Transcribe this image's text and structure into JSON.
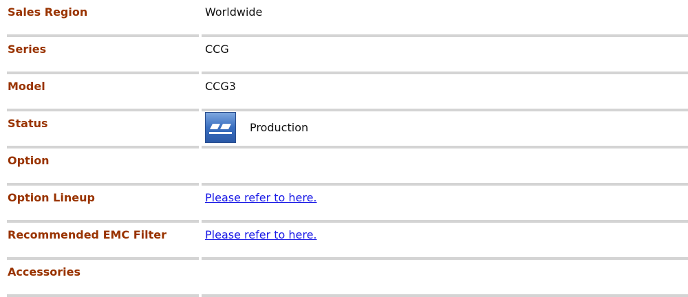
{
  "rows": [
    {
      "label": "Sales Region",
      "value": "Worldwide"
    },
    {
      "label": "Series",
      "value": "CCG"
    },
    {
      "label": "Model",
      "value": "CCG3"
    },
    {
      "label": "Status",
      "value": "Production",
      "icon": "production-status-icon"
    },
    {
      "label": "Option",
      "value": ""
    },
    {
      "label": "Option Lineup",
      "value": "Please refer to here.",
      "link": true
    },
    {
      "label": "Recommended EMC Filter",
      "value": "Please refer to here.",
      "link": true
    },
    {
      "label": "Accessories",
      "value": ""
    }
  ],
  "colors": {
    "label": "#993300",
    "link": "#1a1ae6",
    "divider": "#d4d4d4",
    "icon_blue": "#3a6fc0"
  }
}
